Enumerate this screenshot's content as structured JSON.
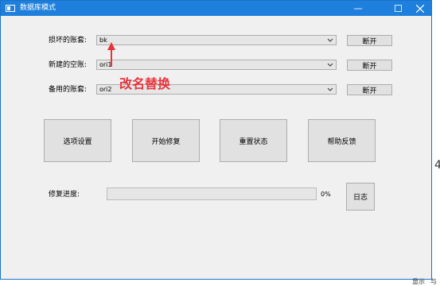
{
  "window": {
    "title": "数据库模式"
  },
  "rows": [
    {
      "label": "损坏的账套:",
      "value": "bk",
      "disconnect_label": "断开"
    },
    {
      "label": "新建的空账:",
      "value": "ori1",
      "disconnect_label": "断开"
    },
    {
      "label": "备用的账套:",
      "value": "ori2",
      "disconnect_label": "断开"
    }
  ],
  "actions": {
    "options": "选项设置",
    "start": "开始修复",
    "reset": "重置状态",
    "help": "帮助反馈"
  },
  "progress": {
    "label": "修复进度:",
    "value": 0,
    "text": "0%",
    "log_label": "日志"
  },
  "annotation": {
    "text": "改名替换",
    "color": "#e8323c"
  },
  "background_fragments": [
    "4",
    "显示",
    "与"
  ],
  "colors": {
    "titlebar": "#1e80dc",
    "window_bg": "#f0f0f0",
    "annotation": "#e8323c"
  }
}
